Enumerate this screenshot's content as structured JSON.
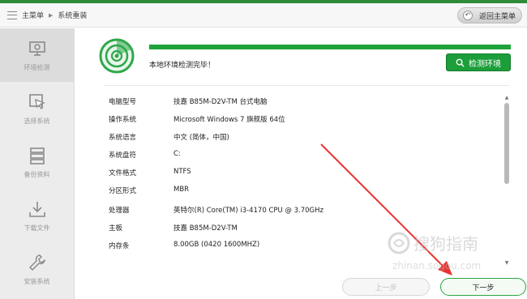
{
  "titlebar": {
    "crumb_main": "主菜单",
    "crumb_current": "系统重装",
    "back_label": "返回主菜单"
  },
  "sidebar": {
    "items": [
      {
        "label": "环境检测",
        "icon": "pc-check-icon",
        "active": true
      },
      {
        "label": "选择系统",
        "icon": "cursor-window-icon",
        "active": false
      },
      {
        "label": "备份资料",
        "icon": "database-icon",
        "active": false
      },
      {
        "label": "下载文件",
        "icon": "download-icon",
        "active": false
      },
      {
        "label": "安装系统",
        "icon": "wrench-icon",
        "active": false
      }
    ]
  },
  "main": {
    "progress": 1.0,
    "status_text": "本地环境检测完毕！",
    "detect_button": "检测环境",
    "info": [
      {
        "key": "电脑型号",
        "value": "技嘉 B85M-D2V-TM 台式电脑"
      },
      {
        "key": "操作系统",
        "value": "Microsoft Windows 7 旗舰版  64位"
      },
      {
        "key": "系统语言",
        "value": "中文 (简体，中国)"
      },
      {
        "key": "系统盘符",
        "value": "C:"
      },
      {
        "key": "文件格式",
        "value": "NTFS"
      },
      {
        "key": "分区形式",
        "value": "MBR"
      },
      {
        "key": "处理器",
        "value": "英特尔(R) Core(TM) i3-4170 CPU @ 3.70GHz"
      },
      {
        "key": "主板",
        "value": "技嘉 B85M-D2V-TM"
      },
      {
        "key": "内存条",
        "value": "8.00GB (0420  1600MHZ)"
      }
    ],
    "prev_button": "上一步",
    "next_button": "下一步"
  },
  "watermark": {
    "text": "搜狗指南",
    "url": "zhinan.sogou.com"
  },
  "colors": {
    "accent": "#1c9e3a",
    "arrow": "#e8322f"
  }
}
